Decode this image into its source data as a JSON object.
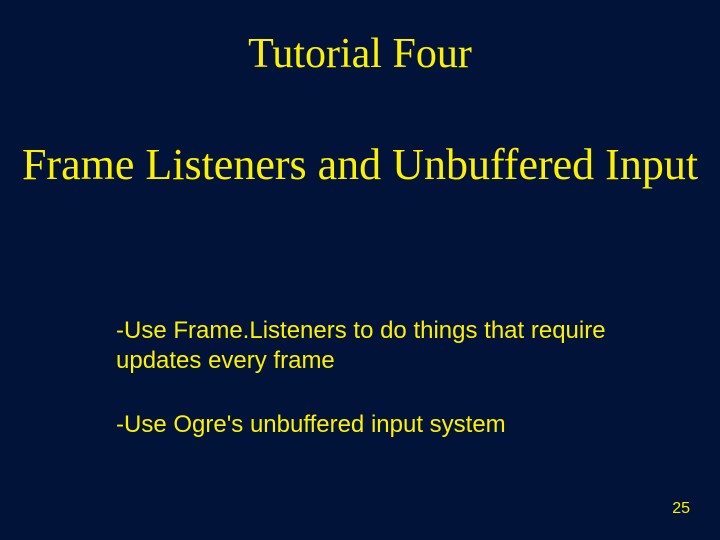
{
  "slide": {
    "title": "Tutorial Four",
    "subtitle": "Frame Listeners and Unbuffered Input",
    "bullets": [
      "-Use Frame.Listeners to do things that require updates every frame",
      "-Use Ogre's unbuffered input system"
    ],
    "page_number": "25"
  }
}
